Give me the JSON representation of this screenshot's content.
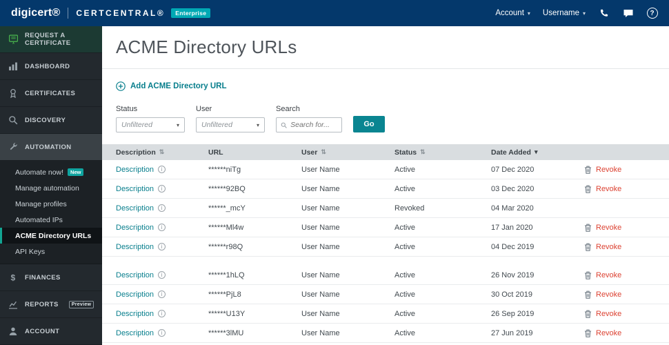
{
  "topbar": {
    "logo": "digicert®",
    "product": "CERTCENTRAL®",
    "badge": "Enterprise",
    "account_label": "Account",
    "username_label": "Username",
    "help_label": "?"
  },
  "sidebar": {
    "items": [
      {
        "label": "REQUEST A CERTIFICATE"
      },
      {
        "label": "DASHBOARD"
      },
      {
        "label": "CERTIFICATES"
      },
      {
        "label": "DISCOVERY"
      },
      {
        "label": "AUTOMATION"
      },
      {
        "label": "FINANCES"
      },
      {
        "label": "REPORTS",
        "badge": "Preview"
      },
      {
        "label": "ACCOUNT"
      }
    ],
    "automation_children": [
      {
        "label": "Automate now!",
        "badge": "New"
      },
      {
        "label": "Manage automation"
      },
      {
        "label": "Manage profiles"
      },
      {
        "label": "Automated IPs"
      },
      {
        "label": "ACME Directory URLs"
      },
      {
        "label": "API Keys"
      }
    ]
  },
  "main": {
    "title": "ACME Directory URLs",
    "add_link": "Add ACME Directory URL",
    "filters": {
      "status_label": "Status",
      "status_value": "Unfiltered",
      "user_label": "User",
      "user_value": "Unfiltered",
      "search_label": "Search",
      "search_placeholder": "Search for...",
      "go_label": "Go"
    },
    "table": {
      "columns": {
        "description": "Description",
        "url": "URL",
        "user": "User",
        "status": "Status",
        "date_added": "Date Added"
      },
      "revoke_label": "Revoke",
      "rows": [
        {
          "description": "Description",
          "url": "******niTg",
          "user": "User Name",
          "status": "Active",
          "date": "07 Dec 2020"
        },
        {
          "description": "Description",
          "url": "******92BQ",
          "user": "User Name",
          "status": "Active",
          "date": "03 Dec 2020"
        },
        {
          "description": "Description",
          "url": "******_mcY",
          "user": "User Name",
          "status": "Revoked",
          "date": "04 Mar 2020"
        },
        {
          "description": "Description",
          "url": "******Ml4w",
          "user": "User Name",
          "status": "Active",
          "date": "17 Jan 2020"
        },
        {
          "description": "Description",
          "url": "******r98Q",
          "user": "User Name",
          "status": "Active",
          "date": "04 Dec 2019"
        },
        {
          "description": "Description",
          "url": "******1hLQ",
          "user": "User Name",
          "status": "Active",
          "date": "26 Nov 2019"
        },
        {
          "description": "Description",
          "url": "******PjL8",
          "user": "User Name",
          "status": "Active",
          "date": "30 Oct 2019"
        },
        {
          "description": "Description",
          "url": "******U13Y",
          "user": "User Name",
          "status": "Active",
          "date": "26 Sep 2019"
        },
        {
          "description": "Description",
          "url": "******3lMU",
          "user": "User Name",
          "status": "Active",
          "date": "27 Jun 2019"
        }
      ]
    }
  }
}
